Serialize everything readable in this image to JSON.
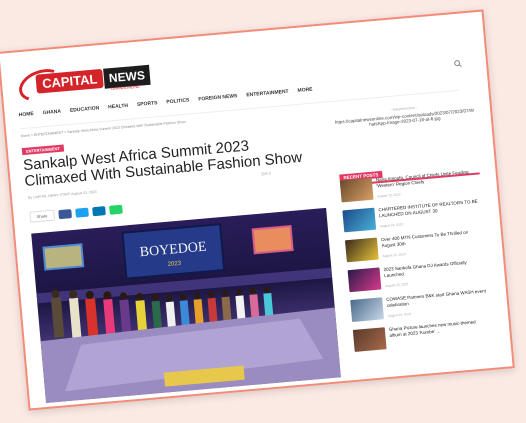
{
  "site": {
    "logo_capital": "CAPITAL",
    "logo_news": "NEWS",
    "logo_sub": "GHANAONLINE"
  },
  "nav": [
    "HOME",
    "GHANA",
    "EDUCATION",
    "HEALTH",
    "SPORTS",
    "POLITICS",
    "FOREIGN NEWS",
    "ENTERTAINMENT",
    "MORE"
  ],
  "breadcrumb": "Home > ENTERTAINMENT > Sankalp West Africa Summit 2023 Climaxed With Sustainable Fashion Show",
  "article": {
    "category": "ENTERTAINMENT",
    "title_line1": "Sankalp West Africa Summit 2023",
    "title_line2": "Climaxed With Sustainable Fashion Show",
    "byline": "By CAPITAL NEWS STAFF   August 23, 2023",
    "meta": "158   0",
    "share_label": "Share"
  },
  "social_colors": [
    "#3b5998",
    "#1da1f2",
    "#0077b5",
    "#25d366"
  ],
  "photo": {
    "banner_text": "BOYEDOE",
    "banner_sub": "2023"
  },
  "sidebar": {
    "ad_label": "- Advertisement -",
    "ad_text": "https://capitalnewsonline.com/wp-content/uploads/2023/07/2023/07/WhatsApp-Image-2023-07-18-at-6.jpg",
    "recent_title": "RECENT POSTS",
    "posts": [
      {
        "title": "Nana Ampofo, Council of Chiefs Unite Feuding 'Western' Region Chiefs",
        "date": "August 23, 2023"
      },
      {
        "title": "CHARTERED INSTITUTE OF REALTORS TO BE LAUNCHED ON AUGUST 30",
        "date": "August 23, 2023"
      },
      {
        "title": "Over 400 MTN Customers To Be Thrilled on August 30th",
        "date": "August 23, 2023"
      },
      {
        "title": "2023 Sankofa Ghana DJ Awards Officially Launched",
        "date": "August 23, 2023"
      },
      {
        "title": "COWASE Partners B&K start Ghana WASH event celebration",
        "date": "August 23, 2023"
      },
      {
        "title": "Ghana Picture launches new music-themed album at 2023 'Kumbe' ...",
        "date": ""
      }
    ]
  }
}
